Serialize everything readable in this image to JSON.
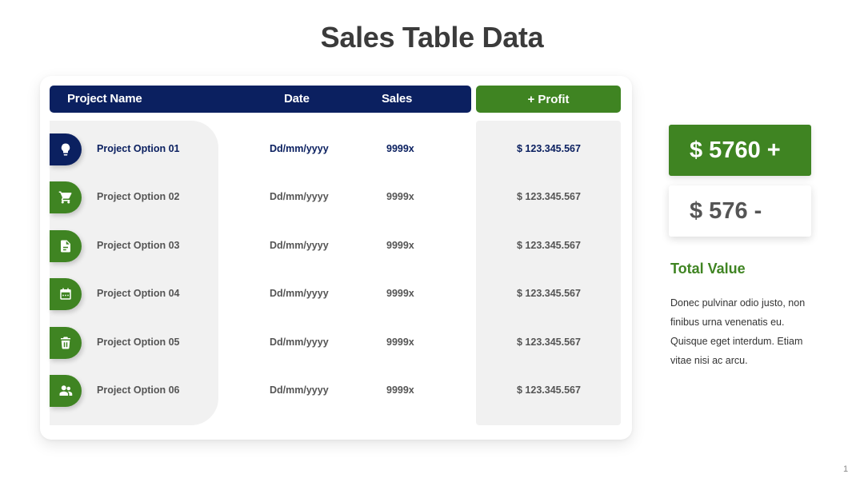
{
  "title": "Sales Table Data",
  "table": {
    "headers": {
      "name": "Project Name",
      "date": "Date",
      "sales": "Sales",
      "profit": "+ Profit"
    },
    "rows": [
      {
        "name": "Project Option 01",
        "date": "Dd/mm/yyyy",
        "sales": "9999x",
        "profit": "$ 123.345.567",
        "icon": "lightbulb-icon",
        "icon_color": "#0b2060",
        "highlight": true
      },
      {
        "name": "Project Option 02",
        "date": "Dd/mm/yyyy",
        "sales": "9999x",
        "profit": "$ 123.345.567",
        "icon": "cart-icon",
        "icon_color": "#3f8422",
        "highlight": false
      },
      {
        "name": "Project Option 03",
        "date": "Dd/mm/yyyy",
        "sales": "9999x",
        "profit": "$ 123.345.567",
        "icon": "document-icon",
        "icon_color": "#3f8422",
        "highlight": false
      },
      {
        "name": "Project Option 04",
        "date": "Dd/mm/yyyy",
        "sales": "9999x",
        "profit": "$ 123.345.567",
        "icon": "calendar-icon",
        "icon_color": "#3f8422",
        "highlight": false
      },
      {
        "name": "Project Option 05",
        "date": "Dd/mm/yyyy",
        "sales": "9999x",
        "profit": "$ 123.345.567",
        "icon": "trash-icon",
        "icon_color": "#3f8422",
        "highlight": false
      },
      {
        "name": "Project Option 06",
        "date": "Dd/mm/yyyy",
        "sales": "9999x",
        "profit": "$ 123.345.567",
        "icon": "users-icon",
        "icon_color": "#3f8422",
        "highlight": false
      }
    ]
  },
  "summary": {
    "positive": "$ 5760 +",
    "negative": "$ 576 -",
    "total_label": "Total Value",
    "description": "Donec pulvinar odio justo, non finibus urna venenatis eu. Quisque eget interdum. Etiam vitae nisi ac arcu."
  },
  "page_number": "1",
  "colors": {
    "navy": "#0b2060",
    "green": "#3f8422",
    "panel": "#f1f1f1"
  }
}
